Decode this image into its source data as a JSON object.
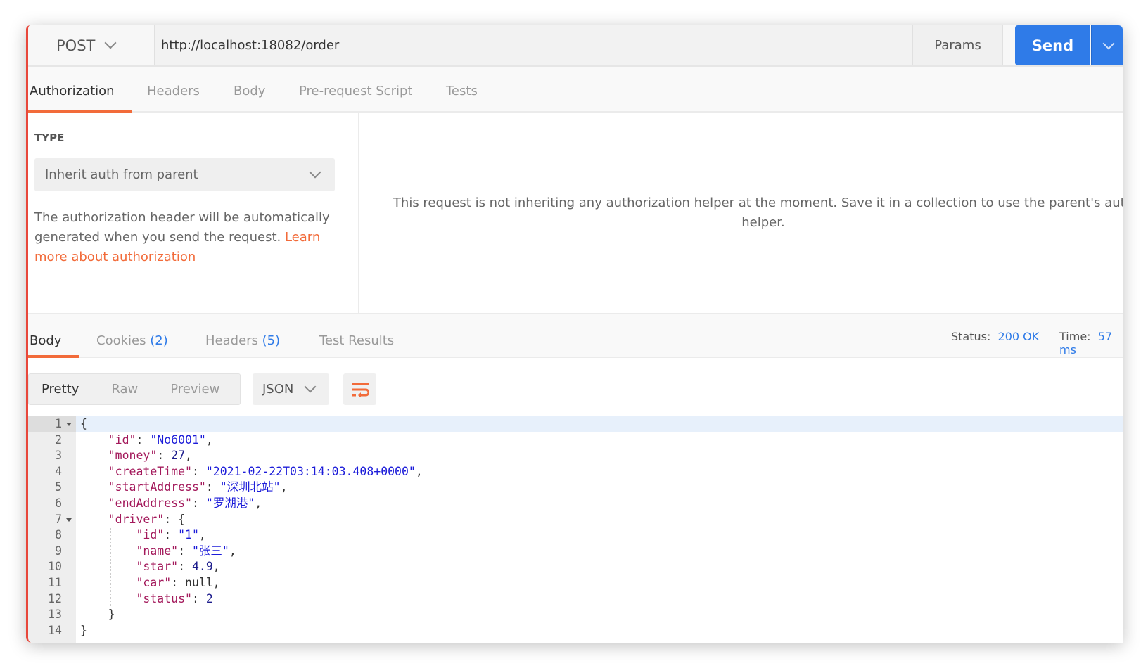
{
  "request": {
    "method": "POST",
    "url": "http://localhost:18082/order",
    "params_label": "Params",
    "send_label": "Send"
  },
  "request_tabs": [
    {
      "label": "Authorization",
      "active": true
    },
    {
      "label": "Headers"
    },
    {
      "label": "Body"
    },
    {
      "label": "Pre-request Script"
    },
    {
      "label": "Tests"
    }
  ],
  "auth": {
    "type_label": "TYPE",
    "type_value": "Inherit auth from parent",
    "description": "The authorization header will be automatically generated when you send the request. ",
    "learn_link": "Learn more about authorization",
    "message_line1": "This request is not inheriting any authorization helper at the moment. Save it in a collection to use the parent's auth",
    "message_line2": "helper."
  },
  "response_tabs": [
    {
      "label": "Body",
      "active": true
    },
    {
      "label": "Cookies",
      "count": "(2)"
    },
    {
      "label": "Headers",
      "count": "(5)"
    },
    {
      "label": "Test Results"
    }
  ],
  "response_status": {
    "status_label": "Status:",
    "status_value": "200 OK",
    "time_label": "Time:",
    "time_value": "57 ms"
  },
  "view_modes": [
    "Pretty",
    "Raw",
    "Preview"
  ],
  "active_view": "Pretty",
  "format": "JSON",
  "colors": {
    "accent": "#f26b3a",
    "send": "#2f7be8",
    "key": "#a3195b",
    "string": "#1c1cd9"
  },
  "code_lines": [
    {
      "n": "1",
      "fold": true,
      "parts": [
        [
          "p",
          "{"
        ]
      ]
    },
    {
      "n": "2",
      "parts": [
        [
          "p",
          "    "
        ],
        [
          "k",
          "\"id\""
        ],
        [
          "p",
          ": "
        ],
        [
          "s",
          "\"No6001\""
        ],
        [
          "p",
          ","
        ]
      ]
    },
    {
      "n": "3",
      "parts": [
        [
          "p",
          "    "
        ],
        [
          "k",
          "\"money\""
        ],
        [
          "p",
          ": "
        ],
        [
          "n",
          "27"
        ],
        [
          "p",
          ","
        ]
      ]
    },
    {
      "n": "4",
      "parts": [
        [
          "p",
          "    "
        ],
        [
          "k",
          "\"createTime\""
        ],
        [
          "p",
          ": "
        ],
        [
          "s",
          "\"2021-02-22T03:14:03.408+0000\""
        ],
        [
          "p",
          ","
        ]
      ]
    },
    {
      "n": "5",
      "parts": [
        [
          "p",
          "    "
        ],
        [
          "k",
          "\"startAddress\""
        ],
        [
          "p",
          ": "
        ],
        [
          "s",
          "\"深圳北站\""
        ],
        [
          "p",
          ","
        ]
      ]
    },
    {
      "n": "6",
      "parts": [
        [
          "p",
          "    "
        ],
        [
          "k",
          "\"endAddress\""
        ],
        [
          "p",
          ": "
        ],
        [
          "s",
          "\"罗湖港\""
        ],
        [
          "p",
          ","
        ]
      ]
    },
    {
      "n": "7",
      "fold": true,
      "parts": [
        [
          "p",
          "    "
        ],
        [
          "k",
          "\"driver\""
        ],
        [
          "p",
          ": {"
        ]
      ]
    },
    {
      "n": "8",
      "parts": [
        [
          "p",
          "        "
        ],
        [
          "k",
          "\"id\""
        ],
        [
          "p",
          ": "
        ],
        [
          "s",
          "\"1\""
        ],
        [
          "p",
          ","
        ]
      ]
    },
    {
      "n": "9",
      "parts": [
        [
          "p",
          "        "
        ],
        [
          "k",
          "\"name\""
        ],
        [
          "p",
          ": "
        ],
        [
          "s",
          "\"张三\""
        ],
        [
          "p",
          ","
        ]
      ]
    },
    {
      "n": "10",
      "parts": [
        [
          "p",
          "        "
        ],
        [
          "k",
          "\"star\""
        ],
        [
          "p",
          ": "
        ],
        [
          "n",
          "4.9"
        ],
        [
          "p",
          ","
        ]
      ]
    },
    {
      "n": "11",
      "parts": [
        [
          "p",
          "        "
        ],
        [
          "k",
          "\"car\""
        ],
        [
          "p",
          ": null,"
        ]
      ]
    },
    {
      "n": "12",
      "parts": [
        [
          "p",
          "        "
        ],
        [
          "k",
          "\"status\""
        ],
        [
          "p",
          ": "
        ],
        [
          "n",
          "2"
        ]
      ]
    },
    {
      "n": "13",
      "parts": [
        [
          "p",
          "    }"
        ]
      ]
    },
    {
      "n": "14",
      "parts": [
        [
          "p",
          "}"
        ]
      ]
    }
  ]
}
